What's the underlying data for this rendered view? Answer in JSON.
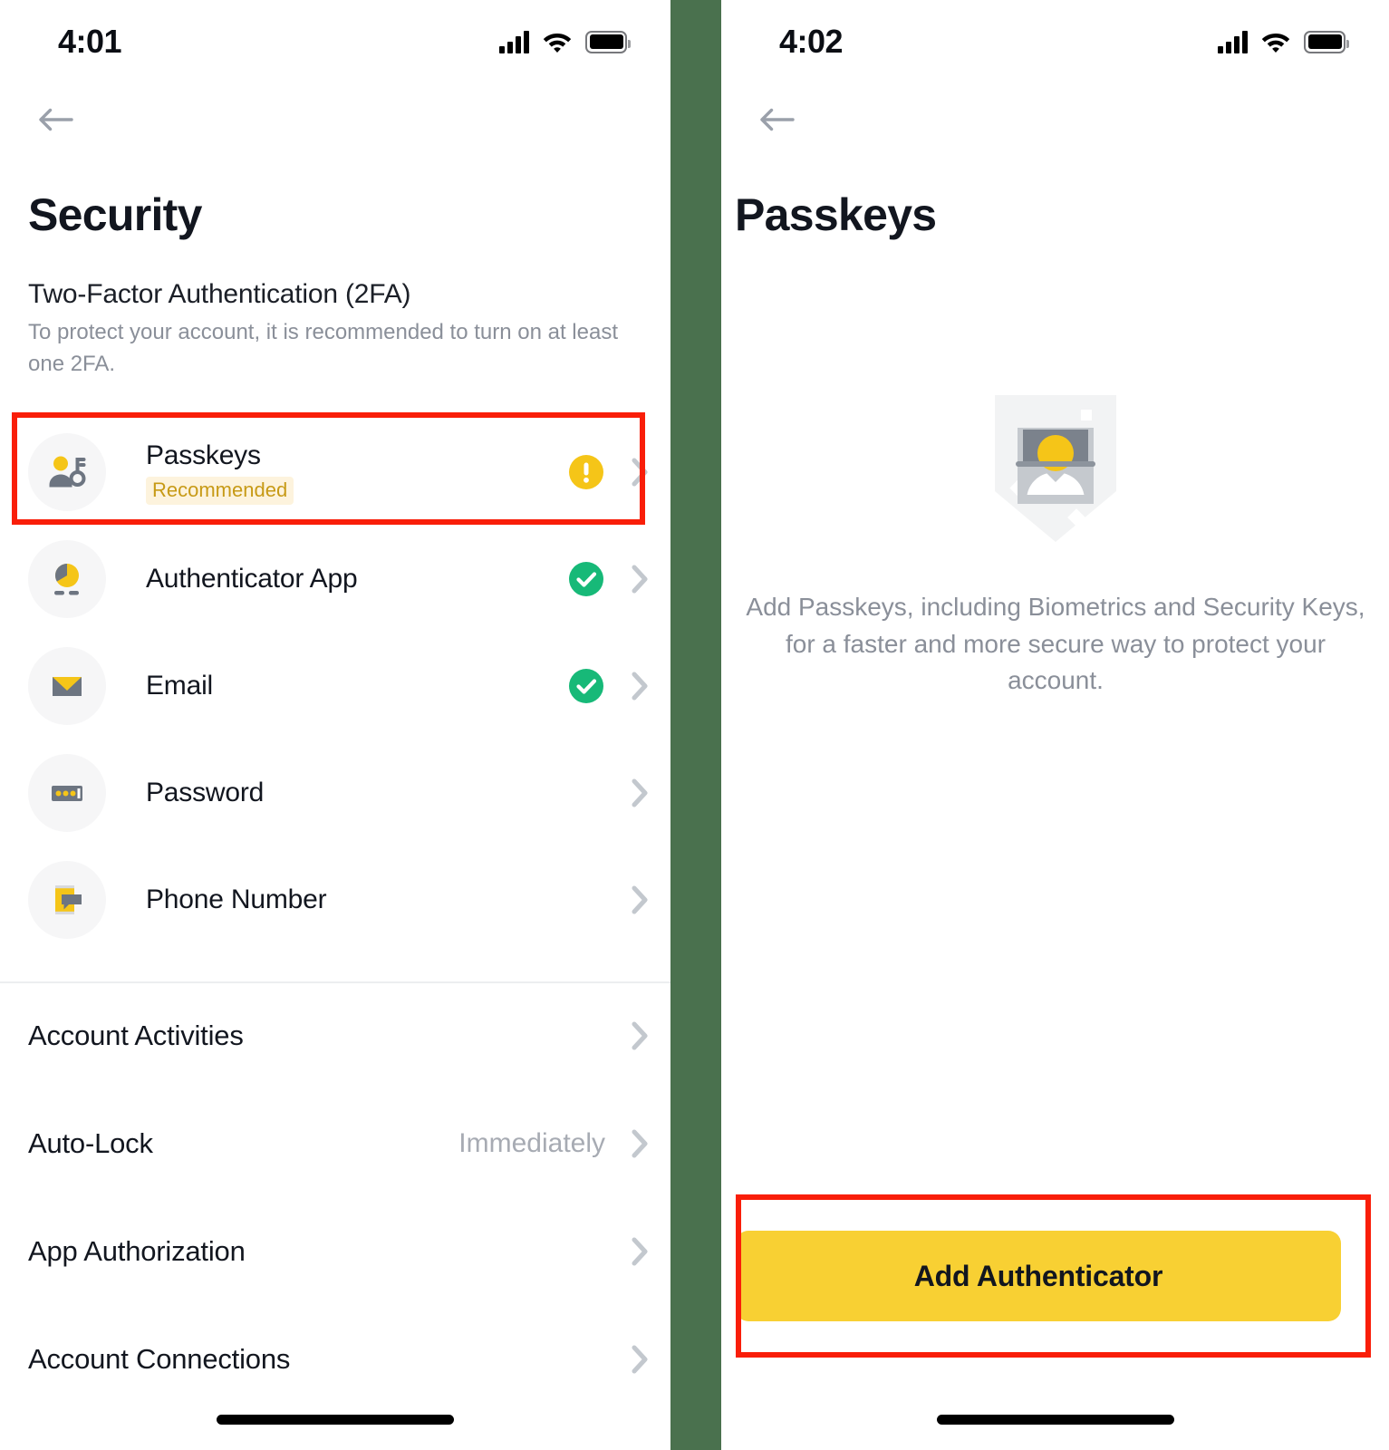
{
  "theme": {
    "accent_yellow": "#f8d033",
    "badge_bg": "#fdf3dd",
    "badge_text": "#c79a16",
    "success_green": "#17b978",
    "warning_yellow": "#f5c518",
    "highlight_red": "#f91e09",
    "divider_green": "#4a714e",
    "muted_text": "#8a8f99",
    "icon_gray": "#6d7581"
  },
  "left_screen": {
    "status_bar": {
      "time": "4:01",
      "signal_icon": "signal-bars-icon",
      "wifi_icon": "wifi-icon",
      "battery_icon": "battery-full-icon"
    },
    "back_icon": "arrow-left-icon",
    "title": "Security",
    "section": {
      "heading": "Two-Factor Authentication (2FA)",
      "description": "To protect your account, it is recommended to turn on at least one 2FA."
    },
    "tfa_items": [
      {
        "icon": "passkey-person-key-icon",
        "label": "Passkeys",
        "badge": "Recommended",
        "status": "warning",
        "chevron": "chevron-right-icon",
        "highlighted": true
      },
      {
        "icon": "authenticator-pie-icon",
        "label": "Authenticator App",
        "badge": "",
        "status": "verified",
        "chevron": "chevron-right-icon",
        "highlighted": false
      },
      {
        "icon": "email-envelope-icon",
        "label": "Email",
        "badge": "",
        "status": "verified",
        "chevron": "chevron-right-icon",
        "highlighted": false
      },
      {
        "icon": "password-dots-icon",
        "label": "Password",
        "badge": "",
        "status": "none",
        "chevron": "chevron-right-icon",
        "highlighted": false
      },
      {
        "icon": "phone-message-icon",
        "label": "Phone Number",
        "badge": "",
        "status": "none",
        "chevron": "chevron-right-icon",
        "highlighted": false
      }
    ],
    "settings_items": [
      {
        "label": "Account Activities",
        "value": "",
        "chevron": "chevron-right-icon"
      },
      {
        "label": "Auto-Lock",
        "value": "Immediately",
        "chevron": "chevron-right-icon"
      },
      {
        "label": "App Authorization",
        "value": "",
        "chevron": "chevron-right-icon"
      },
      {
        "label": "Account Connections",
        "value": "",
        "chevron": "chevron-right-icon"
      }
    ]
  },
  "right_screen": {
    "status_bar": {
      "time": "4:02",
      "signal_icon": "signal-bars-icon",
      "wifi_icon": "wifi-icon",
      "battery_icon": "battery-full-icon"
    },
    "back_icon": "arrow-left-icon",
    "title": "Passkeys",
    "illustration_icon": "passkey-shield-avatar-illustration",
    "description": "Add Passkeys, including Biometrics and Security Keys, for a faster and more secure way to protect your account.",
    "primary_button": "Add Authenticator"
  }
}
